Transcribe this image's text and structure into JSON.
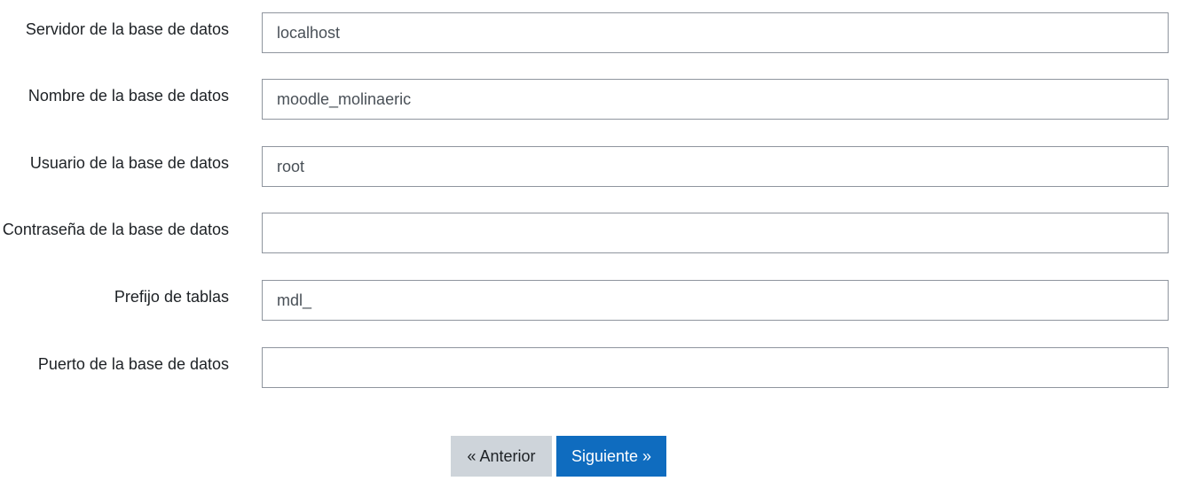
{
  "form": {
    "fields": [
      {
        "label": "Servidor de la base de datos",
        "value": "localhost",
        "type": "text"
      },
      {
        "label": "Nombre de la base de datos",
        "value": "moodle_molinaeric",
        "type": "text"
      },
      {
        "label": "Usuario de la base de datos",
        "value": "root",
        "type": "text"
      },
      {
        "label": "Contraseña de la base de datos",
        "value": "",
        "type": "password"
      },
      {
        "label": "Prefijo de tablas",
        "value": "mdl_",
        "type": "text"
      },
      {
        "label": "Puerto de la base de datos",
        "value": "",
        "type": "text"
      }
    ]
  },
  "buttons": {
    "previous_label": "« Anterior",
    "next_label": "Siguiente »"
  },
  "colors": {
    "primary": "#0f6cbf",
    "secondary": "#ced4da",
    "input_border": "#8f959e"
  }
}
